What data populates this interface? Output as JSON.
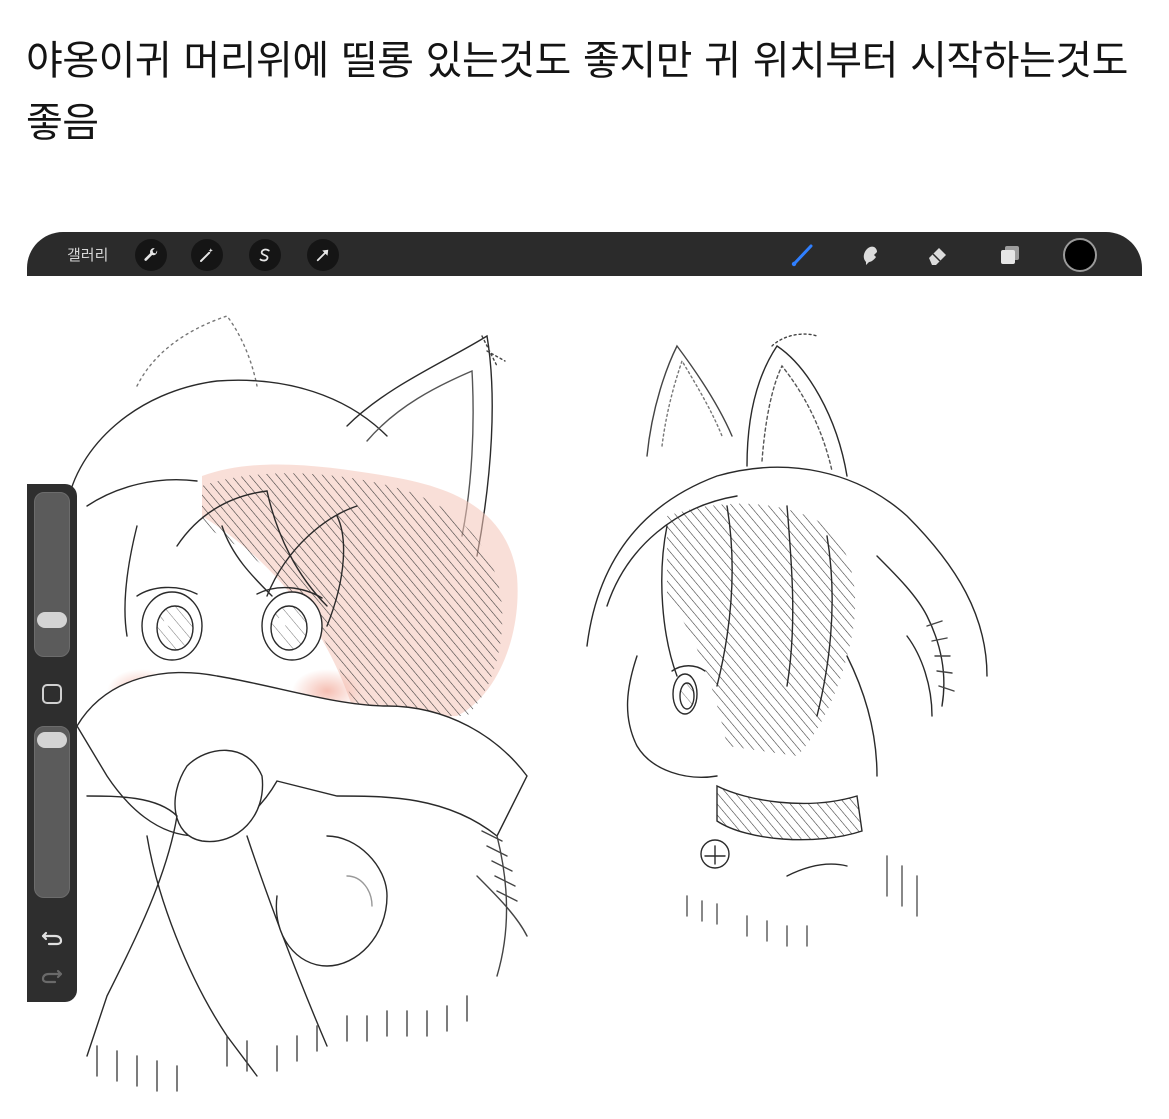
{
  "post": {
    "text": "야옹이귀 머리위에 띨롱 있는것도 좋지만 귀 위치부터 시작하는것도 좋음"
  },
  "app": {
    "gallery_label": "갤러리",
    "left_tools": [
      "wrench-icon",
      "magic-wand-icon",
      "selection-icon",
      "transform-arrow-icon"
    ],
    "right_tools": [
      "brush-icon",
      "smudge-icon",
      "eraser-icon",
      "layers-icon"
    ],
    "active_tool": "brush-icon",
    "active_tool_color": "#2f7fff",
    "current_color": "#000000"
  },
  "sidebar": {
    "brush_size_level": 0.72,
    "opacity_level": 0.95,
    "icons": [
      "undo-icon",
      "redo-icon"
    ]
  },
  "accent": {
    "blush": "#f2a999",
    "hair_tint": "#e8a08a"
  }
}
